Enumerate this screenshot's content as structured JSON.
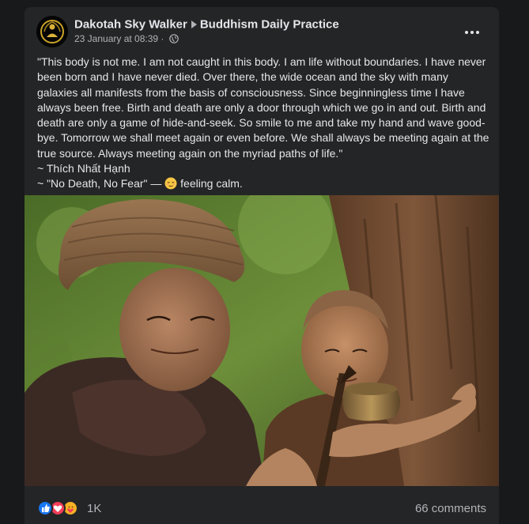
{
  "post": {
    "author": "Dakotah Sky Walker",
    "group": "Buddhism Daily Practice",
    "timestamp": "23 January at 08:39",
    "separator": "·",
    "audience_icon": "globe-icon",
    "more_icon": "more-options-icon",
    "text_lines": [
      "\"This body is not me. I am not caught in this body. I am life without boundaries. I have never been born and I have never died. Over there, the wide ocean and the sky with many galaxies all manifests from the basis of consciousness. Since beginningless time I have always been free. Birth and death are only a door through which we go in and out. Birth and death are only a game of hide-and-seek. So smile to me and take my hand and wave good-bye. Tomorrow we shall meet again or even before. We shall always be meeting again at the true source. Always meeting again on the myriad paths of life.\"",
      " ~ Thích Nhất Hạnh"
    ],
    "book_line": "~ \"No Death, No Fear\" —",
    "feeling": "feeling calm.",
    "feeling_emoji": "relieved-face-emoji"
  },
  "footer": {
    "reaction_icons": [
      "like-icon",
      "love-icon",
      "care-icon"
    ],
    "reaction_count": "1K",
    "comments": "66 comments"
  },
  "colors": {
    "background": "#18191a",
    "card": "#242526",
    "text_primary": "#e4e6eb",
    "text_secondary": "#b0b3b8",
    "like_blue": "#1877f2",
    "love_red": "#f33e58",
    "care_yellow": "#f7b125"
  }
}
